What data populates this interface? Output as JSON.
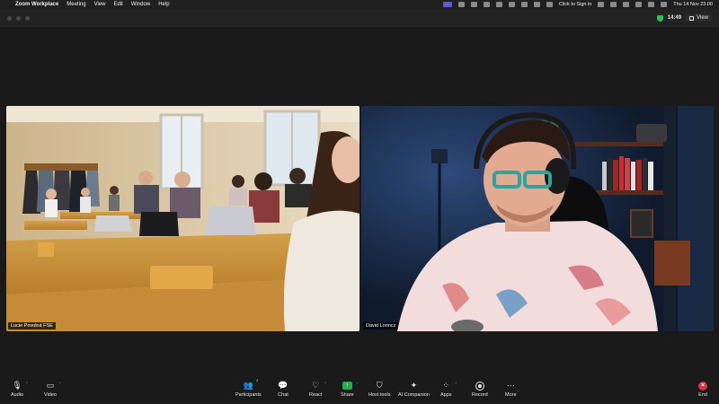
{
  "menubar": {
    "app_name": "Zoom Workplace",
    "menus": [
      "Meeting",
      "View",
      "Edit",
      "Window",
      "Help"
    ],
    "sign_in": "Click to Sign in",
    "clock": "Thu 14 Nov  23.00"
  },
  "titlebar": {
    "timer": "14:49",
    "view_label": "View"
  },
  "participants": [
    {
      "name": "Lucie Povolná FSE"
    },
    {
      "name": "David Lorincz"
    }
  ],
  "controls": {
    "audio": "Audio",
    "video": "Video",
    "participants": "Participants",
    "participants_count": "2",
    "chat": "Chat",
    "react": "React",
    "share": "Share",
    "host_tools": "Host tools",
    "ai_companion": "AI Companion",
    "apps": "Apps",
    "record": "Record",
    "more": "More",
    "end": "End"
  },
  "colors": {
    "share_green": "#22b14c",
    "end_red": "#d9333f",
    "encryption_green": "#2fbf5a"
  }
}
